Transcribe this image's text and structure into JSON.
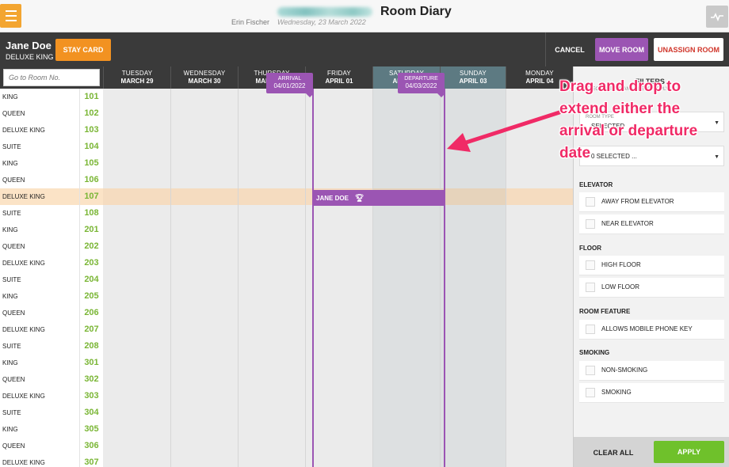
{
  "app": {
    "page_title": "Room Diary",
    "user": "Erin Fischer",
    "date": "Wednesday, 23 March 2022"
  },
  "guest": {
    "name": "Jane Doe",
    "room_type": "DELUXE KING"
  },
  "actions": {
    "stay_card": "STAY CARD",
    "cancel": "CANCEL",
    "move_room": "MOVE ROOM",
    "unassign_room": "UNASSIGN ROOM"
  },
  "search": {
    "placeholder": "Go to Room No."
  },
  "days": [
    {
      "name": "TUESDAY",
      "date": "MARCH 29"
    },
    {
      "name": "WEDNESDAY",
      "date": "MARCH 30"
    },
    {
      "name": "THURSDAY",
      "date": "MARCH 31"
    },
    {
      "name": "FRIDAY",
      "date": "APRIL 01"
    },
    {
      "name": "SATURDAY",
      "date": "APRIL 02"
    },
    {
      "name": "SUNDAY",
      "date": "APRIL 03"
    },
    {
      "name": "MONDAY",
      "date": "APRIL 04"
    }
  ],
  "arrival": {
    "label": "ARRIVAL",
    "date": "04/01/2022"
  },
  "departure": {
    "label": "DEPARTURE",
    "date": "04/03/2022"
  },
  "booking": {
    "guest": "JANE DOE"
  },
  "rooms": [
    {
      "type": "KING",
      "number": "101"
    },
    {
      "type": "QUEEN",
      "number": "102"
    },
    {
      "type": "DELUXE KING",
      "number": "103"
    },
    {
      "type": "SUITE",
      "number": "104"
    },
    {
      "type": "KING",
      "number": "105"
    },
    {
      "type": "QUEEN",
      "number": "106"
    },
    {
      "type": "DELUXE KING",
      "number": "107"
    },
    {
      "type": "SUITE",
      "number": "108"
    },
    {
      "type": "KING",
      "number": "201"
    },
    {
      "type": "QUEEN",
      "number": "202"
    },
    {
      "type": "DELUXE KING",
      "number": "203"
    },
    {
      "type": "SUITE",
      "number": "204"
    },
    {
      "type": "KING",
      "number": "205"
    },
    {
      "type": "QUEEN",
      "number": "206"
    },
    {
      "type": "DELUXE KING",
      "number": "207"
    },
    {
      "type": "SUITE",
      "number": "208"
    },
    {
      "type": "KING",
      "number": "301"
    },
    {
      "type": "QUEEN",
      "number": "302"
    },
    {
      "type": "DELUXE KING",
      "number": "303"
    },
    {
      "type": "SUITE",
      "number": "304"
    },
    {
      "type": "KING",
      "number": "305"
    },
    {
      "type": "QUEEN",
      "number": "306"
    },
    {
      "type": "DELUXE KING",
      "number": "307"
    }
  ],
  "filters": {
    "title": "FILTERS",
    "subtitle": "SELECT FILTERS AND PRESS \"APPLY\"",
    "room_type_label": "ROOM TYPE",
    "room_type_value": "SELECTED",
    "second_value": "0 SELECTED ...",
    "elevator": {
      "title": "ELEVATOR",
      "options": [
        "AWAY FROM ELEVATOR",
        "NEAR ELEVATOR"
      ]
    },
    "floor": {
      "title": "FLOOR",
      "options": [
        "HIGH FLOOR",
        "LOW FLOOR"
      ]
    },
    "room_feature": {
      "title": "ROOM FEATURE",
      "options": [
        "ALLOWS MOBILE PHONE KEY"
      ]
    },
    "smoking": {
      "title": "SMOKING",
      "options": [
        "NON-SMOKING",
        "SMOKING"
      ]
    },
    "clear_all": "CLEAR ALL",
    "apply": "APPLY"
  },
  "annotation": {
    "text": "Drag and drop to extend either the arrival or departure date"
  },
  "colors": {
    "accent_purple": "#9b55b3",
    "stay_card_orange": "#f29221",
    "apply_green": "#6fc12b",
    "unassign_red": "#d0352a",
    "room_number_green": "#7ab635",
    "annotation_pink": "#f02a66"
  }
}
